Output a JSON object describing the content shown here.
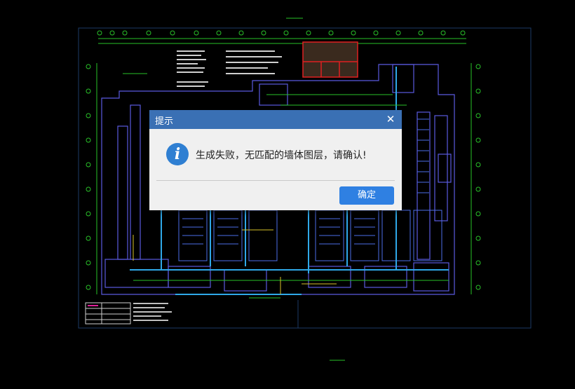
{
  "dialog": {
    "title": "提示",
    "close_glyph": "✕",
    "icon": "info-icon",
    "icon_glyph": "i",
    "message": "生成失败，无匹配的墙体图层，请确认!",
    "ok_label": "确定"
  },
  "colors": {
    "titlebar": "#3a70b4",
    "button": "#2f80e2",
    "background": "#000000",
    "cad_frame": "#1c3a66",
    "cad_grid": "#29c229",
    "cad_walls": "#5a5ae0",
    "cad_pipes": "#2fa8e8",
    "cad_red": "#e02020"
  }
}
